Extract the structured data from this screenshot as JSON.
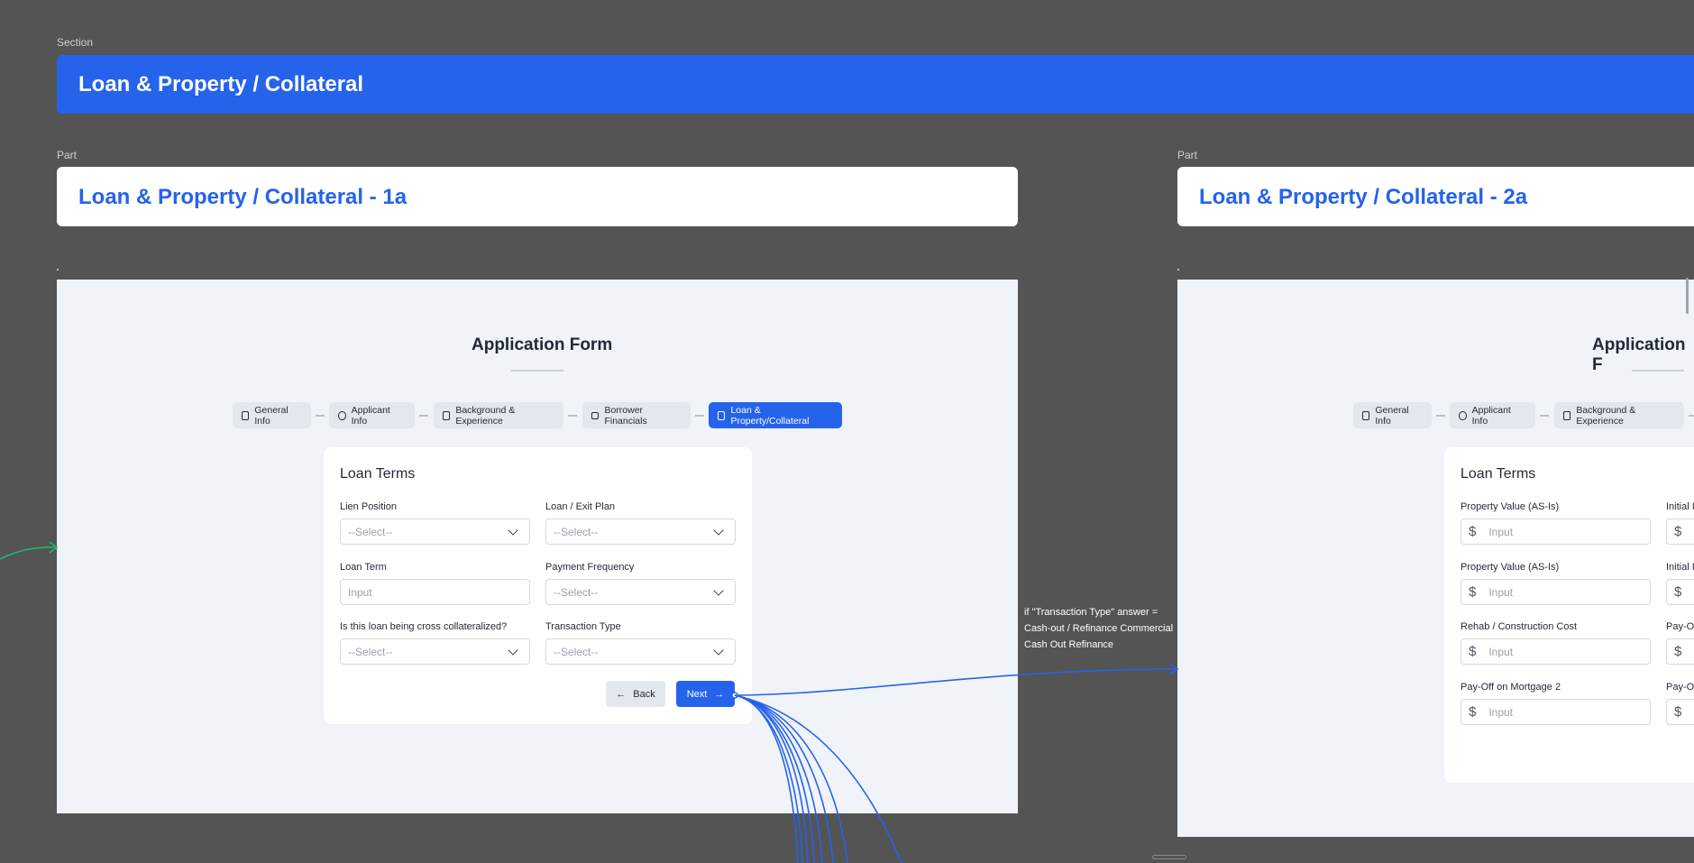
{
  "canvas": {
    "section_label": "Section",
    "section_title": "Loan & Property / Collateral",
    "part_label": "Part",
    "part_1a_title": "Loan & Property / Collateral - 1a",
    "part_2a_title": "Loan & Property / Collateral - 2a",
    "condition_note": "if \"Transaction Type\" answer = Cash-out / Refinance Commercial Cash Out Refinance"
  },
  "frame1a": {
    "title": "Application Form",
    "steps": [
      {
        "label": "General Info",
        "icon": "document-icon"
      },
      {
        "label": "Applicant Info",
        "icon": "badge-icon"
      },
      {
        "label": "Background & Experience",
        "icon": "briefcase-icon"
      },
      {
        "label": "Borrower Financials",
        "icon": "card-icon"
      },
      {
        "label": "Loan & Property/Collateral",
        "icon": "bank-icon",
        "active": true
      }
    ],
    "card_title": "Loan Terms",
    "fields": [
      {
        "label": "Lien Position",
        "value": "--Select--"
      },
      {
        "label": "Loan / Exit Plan",
        "value": "--Select--"
      },
      {
        "label": "Loan Term",
        "value": "Input"
      },
      {
        "label": "Payment Frequency",
        "value": "--Select--"
      },
      {
        "label": "Is this loan being cross collateralized?",
        "value": "--Select--"
      },
      {
        "label": "Transaction Type",
        "value": "--Select--"
      }
    ],
    "back_label": "Back",
    "next_label": "Next",
    "back_arrow": "←",
    "next_arrow": "→"
  },
  "frame2a": {
    "title": "Application F",
    "steps": [
      {
        "label": "General Info",
        "icon": "document-icon"
      },
      {
        "label": "Applicant Info",
        "icon": "badge-icon"
      },
      {
        "label": "Background & Experience",
        "icon": "briefcase-icon"
      }
    ],
    "card_title": "Loan Terms",
    "fields": [
      {
        "label": "Property Value (AS-Is)",
        "value": "Input"
      },
      {
        "label": "Initial I",
        "value": ""
      },
      {
        "label": "Property Value (AS-Is)",
        "value": "Input"
      },
      {
        "label": "Initial I",
        "value": ""
      },
      {
        "label": "Rehab / Construction Cost",
        "value": "Input"
      },
      {
        "label": "Pay-O",
        "value": ""
      },
      {
        "label": "Pay-Off on Mortgage 2",
        "value": "Input"
      },
      {
        "label": "Pay-O",
        "value": ""
      }
    ],
    "currency_symbol": "$"
  },
  "colors": {
    "accent": "#2563eb",
    "canvas": "#545454",
    "connector_green": "#22b573"
  }
}
